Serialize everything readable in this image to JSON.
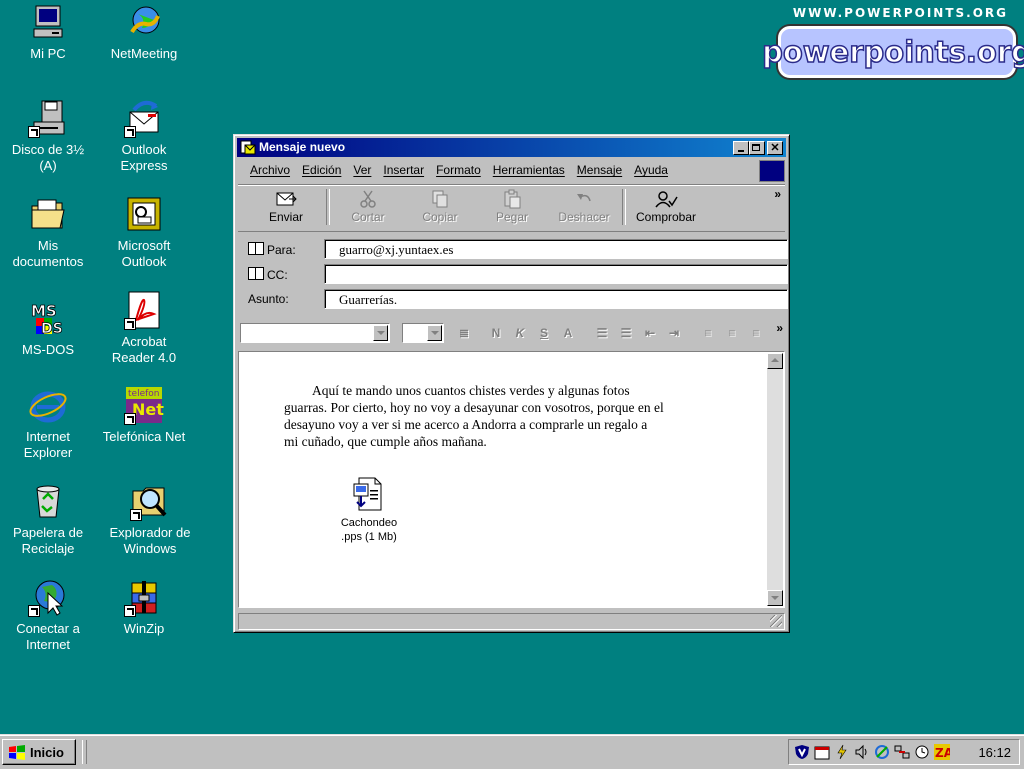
{
  "desktop": {
    "icons": [
      {
        "label": "Mi PC"
      },
      {
        "label": "NetMeeting"
      },
      {
        "label": "Disco de 3½\n(A)"
      },
      {
        "label": "Outlook\nExpress"
      },
      {
        "label": "Mis\ndocumentos"
      },
      {
        "label": "Microsoft\nOutlook"
      },
      {
        "label": "MS-DOS"
      },
      {
        "label": "Acrobat\nReader 4.0"
      },
      {
        "label": "Internet\nExplorer"
      },
      {
        "label": "Telefónica Net"
      },
      {
        "label": "Papelera de\nReciclaje"
      },
      {
        "label": "Explorador de\nWindows"
      },
      {
        "label": "Conectar a\nInternet"
      },
      {
        "label": "WinZip"
      }
    ]
  },
  "watermark": {
    "url": "WWW.POWERPOINTS.ORG",
    "logo": "powerpoints.org"
  },
  "window": {
    "title": "Mensaje nuevo",
    "menu": [
      "Archivo",
      "Edición",
      "Ver",
      "Insertar",
      "Formato",
      "Herramientas",
      "Mensaje",
      "Ayuda"
    ],
    "toolbar": {
      "send": "Enviar",
      "cut": "Cortar",
      "copy": "Copiar",
      "paste": "Pegar",
      "undo": "Deshacer",
      "check": "Comprobar"
    },
    "fields": {
      "to_label": "Para:",
      "to_value": "guarro@xj.yuntaex.es",
      "cc_label": "CC:",
      "cc_value": "",
      "subject_label": "Asunto:",
      "subject_value": "Guarrerías."
    },
    "body": "Aquí te mando unos cuantos chistes verdes y algunas fotos guarras. Por cierto, hoy no voy a desayunar con vosotros, porque en el desayuno voy a ver si me acerco a Andorra a comprarle un regalo a mi cuñado, que cumple años mañana.",
    "attachment": {
      "label": "Cachondeo\n.pps (1 Mb)"
    }
  },
  "taskbar": {
    "start": "Inicio",
    "clock": "16:12"
  }
}
